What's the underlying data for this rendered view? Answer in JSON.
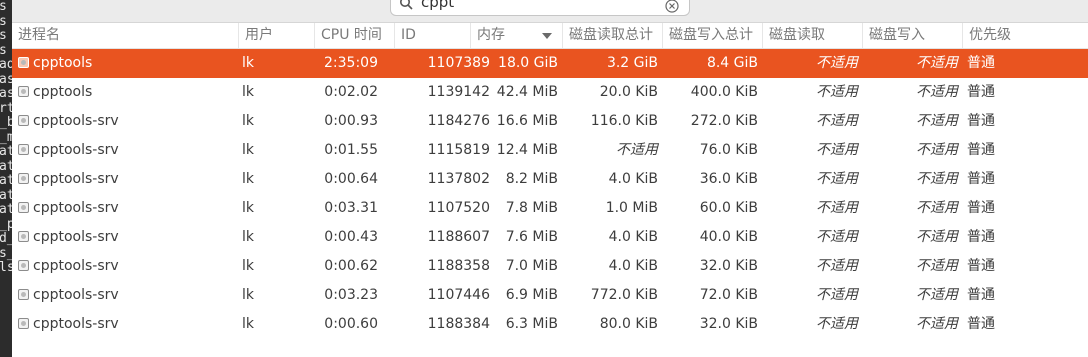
{
  "background_terminal": {
    "lines": [
      "s",
      "s",
      "s",
      "s",
      "ad",
      "as",
      "as",
      "rt",
      "_b",
      "_m",
      "at",
      "at",
      "at",
      "at",
      "at",
      "_p",
      "d_",
      "s_",
      "ls"
    ]
  },
  "search": {
    "value": "cppt"
  },
  "columns": [
    {
      "label": "进程名"
    },
    {
      "label": "用户"
    },
    {
      "label": "CPU 时间"
    },
    {
      "label": "ID"
    },
    {
      "label": "内存"
    },
    {
      "label": "磁盘读取总计"
    },
    {
      "label": "磁盘写入总计"
    },
    {
      "label": "磁盘读取"
    },
    {
      "label": "磁盘写入"
    },
    {
      "label": "优先级"
    }
  ],
  "processes": [
    {
      "name": "cpptools",
      "user": "lk",
      "cpu_time": "2:35:09",
      "id": "1107389",
      "memory": "18.0 GiB",
      "disk_read_total": "3.2 GiB",
      "disk_write_total": "8.4 GiB",
      "disk_read": "不适用",
      "disk_write": "不适用",
      "priority": "普通",
      "selected": true
    },
    {
      "name": "cpptools",
      "user": "lk",
      "cpu_time": "0:02.02",
      "id": "1139142",
      "memory": "42.4 MiB",
      "disk_read_total": "20.0 KiB",
      "disk_write_total": "400.0 KiB",
      "disk_read": "不适用",
      "disk_write": "不适用",
      "priority": "普通"
    },
    {
      "name": "cpptools-srv",
      "user": "lk",
      "cpu_time": "0:00.93",
      "id": "1184276",
      "memory": "16.6 MiB",
      "disk_read_total": "116.0 KiB",
      "disk_write_total": "272.0 KiB",
      "disk_read": "不适用",
      "disk_write": "不适用",
      "priority": "普通"
    },
    {
      "name": "cpptools-srv",
      "user": "lk",
      "cpu_time": "0:01.55",
      "id": "1115819",
      "memory": "12.4 MiB",
      "disk_read_total": "不适用",
      "disk_write_total": "76.0 KiB",
      "disk_read": "不适用",
      "disk_write": "不适用",
      "priority": "普通"
    },
    {
      "name": "cpptools-srv",
      "user": "lk",
      "cpu_time": "0:00.64",
      "id": "1137802",
      "memory": "8.2 MiB",
      "disk_read_total": "4.0 KiB",
      "disk_write_total": "36.0 KiB",
      "disk_read": "不适用",
      "disk_write": "不适用",
      "priority": "普通"
    },
    {
      "name": "cpptools-srv",
      "user": "lk",
      "cpu_time": "0:03.31",
      "id": "1107520",
      "memory": "7.8 MiB",
      "disk_read_total": "1.0 MiB",
      "disk_write_total": "60.0 KiB",
      "disk_read": "不适用",
      "disk_write": "不适用",
      "priority": "普通"
    },
    {
      "name": "cpptools-srv",
      "user": "lk",
      "cpu_time": "0:00.43",
      "id": "1188607",
      "memory": "7.6 MiB",
      "disk_read_total": "4.0 KiB",
      "disk_write_total": "40.0 KiB",
      "disk_read": "不适用",
      "disk_write": "不适用",
      "priority": "普通"
    },
    {
      "name": "cpptools-srv",
      "user": "lk",
      "cpu_time": "0:00.62",
      "id": "1188358",
      "memory": "7.0 MiB",
      "disk_read_total": "4.0 KiB",
      "disk_write_total": "32.0 KiB",
      "disk_read": "不适用",
      "disk_write": "不适用",
      "priority": "普通"
    },
    {
      "name": "cpptools-srv",
      "user": "lk",
      "cpu_time": "0:03.23",
      "id": "1107446",
      "memory": "6.9 MiB",
      "disk_read_total": "772.0 KiB",
      "disk_write_total": "72.0 KiB",
      "disk_read": "不适用",
      "disk_write": "不适用",
      "priority": "普通"
    },
    {
      "name": "cpptools-srv",
      "user": "lk",
      "cpu_time": "0:00.60",
      "id": "1188384",
      "memory": "6.3 MiB",
      "disk_read_total": "80.0 KiB",
      "disk_write_total": "32.0 KiB",
      "disk_read": "不适用",
      "disk_write": "不适用",
      "priority": "普通"
    }
  ],
  "colors": {
    "selection": "#e95420",
    "header_text": "#7a7a7a",
    "text": "#3d3d3d"
  },
  "icons": {
    "search": "search-icon",
    "clear": "clear-icon",
    "process": "process-icon",
    "sort": "sort-descending-icon"
  }
}
